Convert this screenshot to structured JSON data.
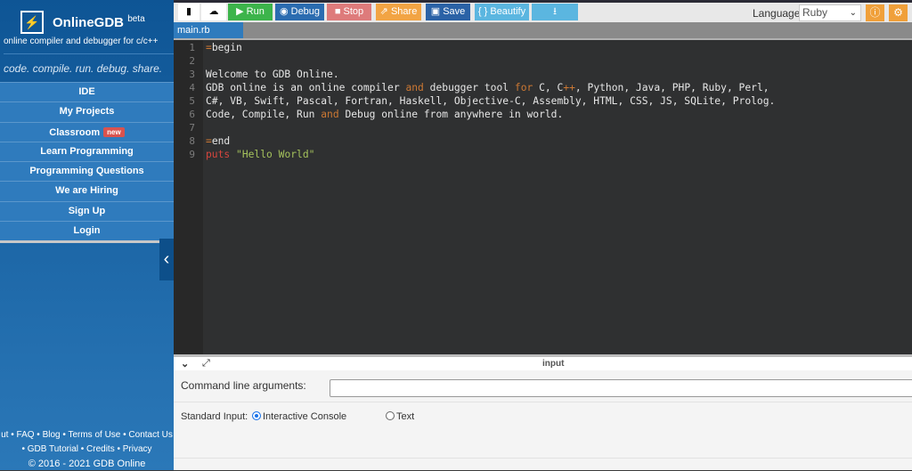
{
  "brand": {
    "name": "OnlineGDB",
    "sup": "beta",
    "tagline": "online compiler and debugger for c/c++",
    "motto": "code. compile. run. debug. share."
  },
  "menu": [
    {
      "label": "IDE"
    },
    {
      "label": "My Projects"
    },
    {
      "label": "Classroom",
      "badge": "new"
    },
    {
      "label": "Learn Programming"
    },
    {
      "label": "Programming Questions"
    },
    {
      "label": "We are Hiring"
    },
    {
      "label": "Sign Up"
    },
    {
      "label": "Login"
    }
  ],
  "footer": {
    "line1": "ut • FAQ • Blog • Terms of Use • Contact Us",
    "line2": "• GDB Tutorial • Credits • Privacy",
    "line3": "© 2016 - 2021 GDB Online"
  },
  "toolbar": {
    "run": "Run",
    "debug": "Debug",
    "stop": "Stop",
    "share": "Share",
    "save": "Save",
    "beautify": "{ } Beautify",
    "language_label": "Language",
    "language": "Ruby"
  },
  "colors": {
    "run": "#3cb44b",
    "debug": "#2b6cb0",
    "stop": "#de7b7b",
    "share": "#f2a444",
    "save": "#2b62a6",
    "beautify": "#5bb6e0",
    "download": "#5bb6e0"
  },
  "tab": "main.rb",
  "code": [
    [
      {
        "t": "=",
        "c": "eq"
      },
      {
        "t": "begin"
      }
    ],
    [],
    [
      {
        "t": "Welcome to GDB Online."
      }
    ],
    [
      {
        "t": "GDB online is an online compiler "
      },
      {
        "t": "and",
        "c": "kw"
      },
      {
        "t": " debugger tool "
      },
      {
        "t": "for",
        "c": "kw"
      },
      {
        "t": " C, C"
      },
      {
        "t": "++",
        "c": "kw"
      },
      {
        "t": ", Python, Java, PHP, Ruby, Perl,"
      }
    ],
    [
      {
        "t": "C#, VB, Swift, Pascal, Fortran, Haskell, Objective-C, Assembly, HTML, CSS, JS, SQLite, Prolog."
      }
    ],
    [
      {
        "t": "Code, Compile, Run "
      },
      {
        "t": "and",
        "c": "kw"
      },
      {
        "t": " Debug online from anywhere in world."
      }
    ],
    [],
    [
      {
        "t": "=",
        "c": "eq"
      },
      {
        "t": "end"
      }
    ],
    [
      {
        "t": "puts",
        "c": "fn"
      },
      {
        "t": " "
      },
      {
        "t": "\"Hello World\"",
        "c": "str"
      }
    ]
  ],
  "input": {
    "title": "input",
    "cmd_label": "Command line arguments:",
    "cmd_value": "",
    "stdin_label": "Standard Input:",
    "opt1": "Interactive Console",
    "opt2": "Text",
    "selected": "Interactive Console"
  }
}
